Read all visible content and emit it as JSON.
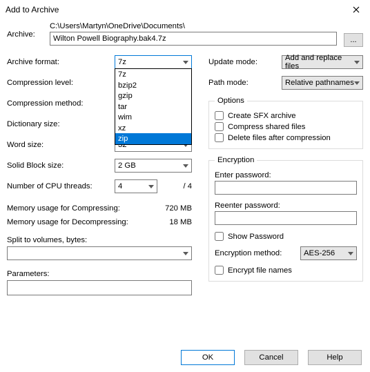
{
  "title": "Add to Archive",
  "archive_label": "Archive:",
  "archive_path_dir": "C:\\Users\\Martyn\\OneDrive\\Documents\\",
  "archive_filename": "Wilton Powell Biography.bak4.7z",
  "browse_btn": "...",
  "left": {
    "format_label": "Archive format:",
    "format_value": "7z",
    "format_options": [
      "7z",
      "bzip2",
      "gzip",
      "tar",
      "wim",
      "xz",
      "zip"
    ],
    "format_selected": "zip",
    "level_label": "Compression level:",
    "level_value": "",
    "method_label": "Compression method:",
    "method_value": "",
    "dict_label": "Dictionary size:",
    "dict_value": "",
    "word_label": "Word size:",
    "word_value": "32",
    "block_label": "Solid Block size:",
    "block_value": "2 GB",
    "threads_label": "Number of CPU threads:",
    "threads_value": "4",
    "threads_total": "/ 4",
    "mem_comp_label": "Memory usage for Compressing:",
    "mem_comp_value": "720 MB",
    "mem_decomp_label": "Memory usage for Decompressing:",
    "mem_decomp_value": "18 MB",
    "split_label": "Split to volumes, bytes:",
    "params_label": "Parameters:"
  },
  "right": {
    "update_label": "Update mode:",
    "update_value": "Add and replace files",
    "path_label": "Path mode:",
    "path_value": "Relative pathnames",
    "options_legend": "Options",
    "opt_sfx": "Create SFX archive",
    "opt_shared": "Compress shared files",
    "opt_delete": "Delete files after compression",
    "enc_legend": "Encryption",
    "enc_enter": "Enter password:",
    "enc_reenter": "Reenter password:",
    "enc_show": "Show Password",
    "enc_method_label": "Encryption method:",
    "enc_method_value": "AES-256",
    "enc_names": "Encrypt file names"
  },
  "buttons": {
    "ok": "OK",
    "cancel": "Cancel",
    "help": "Help"
  }
}
